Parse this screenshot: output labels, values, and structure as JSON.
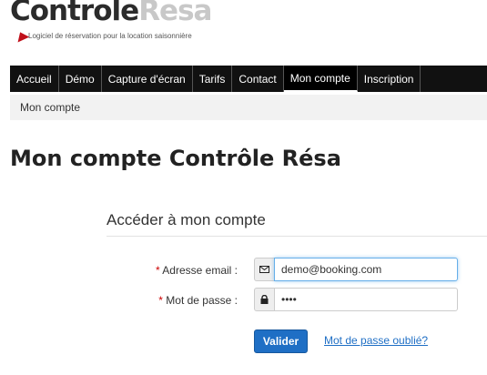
{
  "logo": {
    "part1": "Controle",
    "part2": "Resa",
    "tagline": "Logiciel de réservation pour la location saisonnière"
  },
  "nav": {
    "items": [
      {
        "label": "Accueil"
      },
      {
        "label": "Démo"
      },
      {
        "label": "Capture d'écran"
      },
      {
        "label": "Tarifs"
      },
      {
        "label": "Contact"
      },
      {
        "label": "Mon compte",
        "active": true
      },
      {
        "label": "Inscription"
      }
    ]
  },
  "breadcrumb": {
    "current": "Mon compte"
  },
  "page": {
    "title": "Mon compte Contrôle Résa"
  },
  "form": {
    "legend": "Accéder à mon compte",
    "required_mark": "*",
    "email": {
      "label": "Adresse email :",
      "value": "demo@booking.com",
      "icon": "envelope-icon"
    },
    "password": {
      "label": "Mot de passe :",
      "value": "••••",
      "icon": "lock-icon"
    },
    "submit_label": "Valider",
    "forgot_label": "Mot de passe oublié?"
  },
  "colors": {
    "nav_bg": "#111111",
    "primary": "#1f6fc5",
    "required": "#cc0000",
    "logo_dark": "#2b2b2b",
    "logo_light": "#c8c8c8"
  }
}
